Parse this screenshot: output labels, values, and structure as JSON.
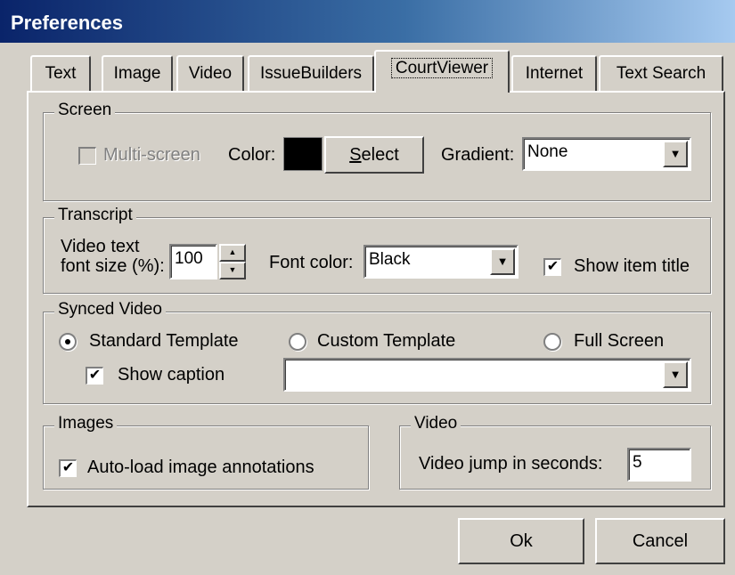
{
  "window": {
    "title": "Preferences"
  },
  "tabs": [
    {
      "label": "Text"
    },
    {
      "label": "Image"
    },
    {
      "label": "Video"
    },
    {
      "label": "IssueBuilders"
    },
    {
      "label": "CourtViewer",
      "active": true
    },
    {
      "label": "Internet"
    },
    {
      "label": "Text Search"
    }
  ],
  "screen": {
    "legend": "Screen",
    "multiscreen_label": "Multi-screen",
    "multiscreen_checked": false,
    "color_label": "Color:",
    "color_value": "#000000",
    "select_first": "S",
    "select_rest": "elect",
    "gradient_label": "Gradient:",
    "gradient_value": "None"
  },
  "transcript": {
    "legend": "Transcript",
    "font_size_label_line1": "Video text",
    "font_size_label_line2": "font size (%):",
    "font_size_value": "100",
    "font_color_label": "Font color:",
    "font_color_value": "Black",
    "show_item_title_label": "Show item title",
    "show_item_title_checked": true
  },
  "synced_video": {
    "legend": "Synced Video",
    "standard_label": "Standard Template",
    "custom_label": "Custom Template",
    "fullscreen_label": "Full Screen",
    "selected": "standard",
    "show_caption_label": "Show caption",
    "show_caption_checked": true,
    "template_value": ""
  },
  "images": {
    "legend": "Images",
    "autoload_label": "Auto-load image annotations",
    "autoload_checked": true
  },
  "video": {
    "legend": "Video",
    "jump_label": "Video jump in seconds:",
    "jump_value": "5"
  },
  "buttons": {
    "ok": "Ok",
    "cancel": "Cancel"
  },
  "glyphs": {
    "check": "✔",
    "arrow_down": "▼",
    "spin_up": "▲",
    "spin_down": "▼"
  }
}
